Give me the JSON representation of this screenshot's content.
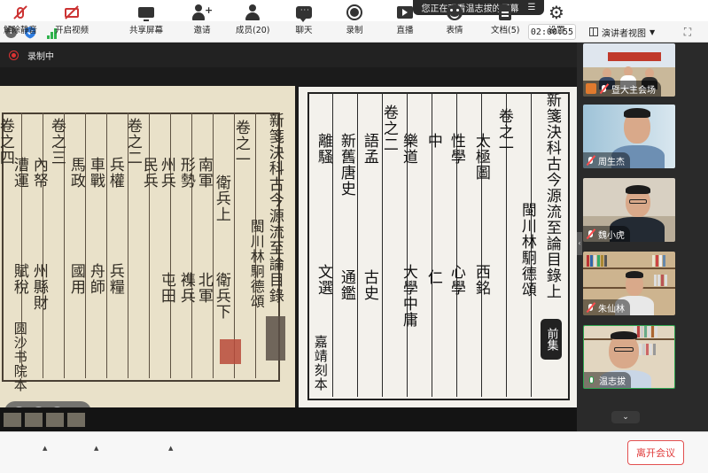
{
  "banner": {
    "text": "您正在观看温志拔的屏幕"
  },
  "toolbar": {
    "timer": "02:00:55",
    "view_mode": "演讲者视图"
  },
  "share": {
    "recording_label": "录制中"
  },
  "book_left": {
    "title_col": "新箋決科古今源流至論目錄",
    "author_col": "閩川林駉德頌",
    "juan_1": "卷之一",
    "juan_2": "卷之二",
    "juan_3": "卷之三",
    "juan_4": "卷之四",
    "c1a": "衛兵上",
    "c1b": "衛兵下",
    "c2a": "南軍",
    "c2b": "北軍",
    "c3a": "形勢",
    "c3b": "襍兵",
    "c4a": "州兵",
    "c4b": "屯田",
    "c5a": "民兵",
    "c6a": "兵權",
    "c6b": "兵糧",
    "c7a": "車戰",
    "c7b": "舟師",
    "c8a": "馬政",
    "c8b": "國用",
    "c9a": "內帑",
    "c9b": "州縣財",
    "c10a": "漕運",
    "c10b": "賦稅",
    "watermark": "圆沙书院本"
  },
  "book_right": {
    "title_col": "新箋決科古今源流至論目錄上",
    "author_col": "閩川林駉德頌",
    "seal": "前集",
    "juan_1": "卷之一",
    "juan_2": "卷之二",
    "c1a": "太極圖",
    "c1b": "西銘",
    "c2a": "性學",
    "c2b": "心學",
    "c3a": "中",
    "c3b": "仁",
    "c4a": "樂道",
    "c4b": "大學中庸",
    "c5a": "語孟",
    "c5b": "古史",
    "c6a": "新舊唐史",
    "c6b": "通鑑",
    "c7a": "離騷",
    "c7b": "文選",
    "footer": "嘉靖刻本"
  },
  "participants": [
    {
      "name": "暨大主会场",
      "mic": "off",
      "label_icon": "avatar-icon"
    },
    {
      "name": "周生杰",
      "mic": "off"
    },
    {
      "name": "魏小虎",
      "mic": "off"
    },
    {
      "name": "朱仙林",
      "mic": "off"
    },
    {
      "name": "温志拔",
      "mic": "on"
    }
  ],
  "bottom": {
    "mute": "解除静音",
    "video": "开启视频",
    "share": "共享屏幕",
    "invite": "邀请",
    "members": "成员(20)",
    "chat": "聊天",
    "record": "录制",
    "live": "直播",
    "emoji": "表情",
    "docs": "文档(5)",
    "settings": "设置",
    "leave": "离开会议"
  },
  "colors": {
    "accent_red": "#e03b3b",
    "signal_green": "#2fb24c",
    "paper_left": "#e9e1c9",
    "paper_right": "#f3f1ec"
  }
}
